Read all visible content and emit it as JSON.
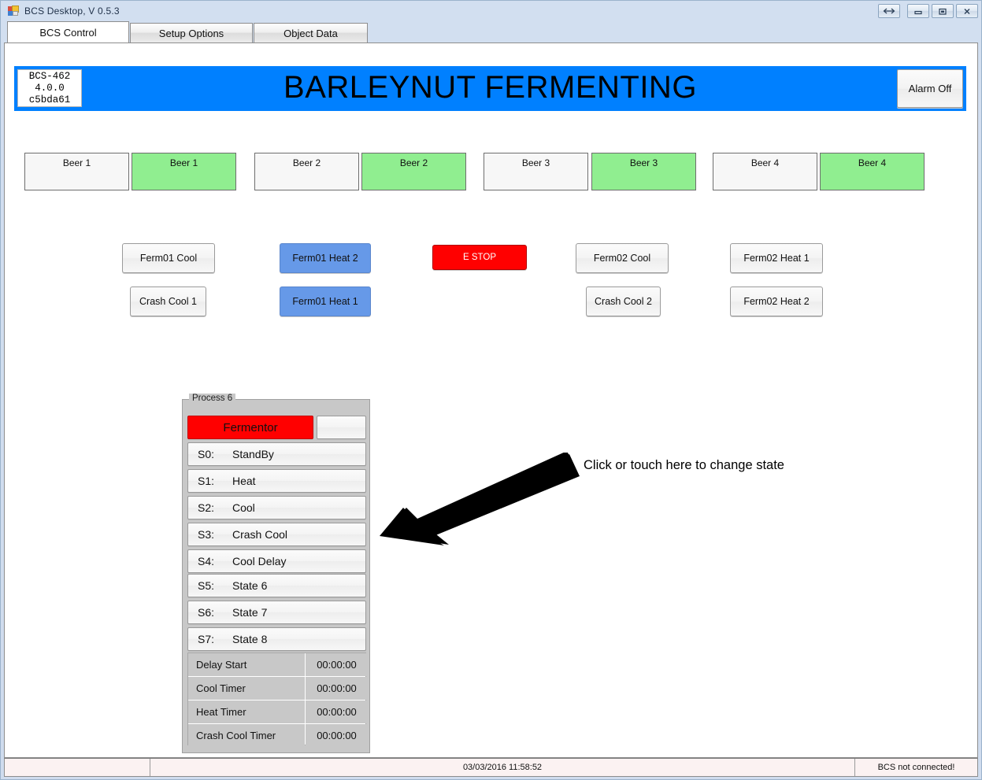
{
  "window": {
    "title": "BCS Desktop, V 0.5.3",
    "icon": "app-icon",
    "controls": [
      {
        "name": "restore-size-button",
        "icon": "double-arrow-icon"
      },
      {
        "name": "minimize-button",
        "icon": "minimize-icon"
      },
      {
        "name": "maximize-button",
        "icon": "maximize-icon"
      },
      {
        "name": "close-button",
        "icon": "close-icon"
      }
    ]
  },
  "tabs": [
    {
      "label": "BCS Control",
      "active": true
    },
    {
      "label": "Setup Options",
      "active": false
    },
    {
      "label": "Object Data",
      "active": false
    }
  ],
  "banner": {
    "title": "BARLEYNUT FERMENTING",
    "background_color": "#0080ff",
    "version": {
      "model": "BCS-462",
      "version": "4.0.0",
      "build": "c5bda61"
    },
    "alarm_button": "Alarm Off"
  },
  "beer_buttons": [
    {
      "label": "Beer 1",
      "state": "off"
    },
    {
      "label": "Beer 1",
      "state": "on"
    },
    {
      "label": "Beer 2",
      "state": "off"
    },
    {
      "label": "Beer 2",
      "state": "on"
    },
    {
      "label": "Beer 3",
      "state": "off"
    },
    {
      "label": "Beer 3",
      "state": "on"
    },
    {
      "label": "Beer 4",
      "state": "off"
    },
    {
      "label": "Beer 4",
      "state": "on"
    }
  ],
  "control_buttons": [
    {
      "label": "Ferm01 Cool",
      "state": "normal"
    },
    {
      "label": "Crash Cool 1",
      "state": "normal"
    },
    {
      "label": "Ferm01 Heat 2",
      "state": "active-blue"
    },
    {
      "label": "Ferm01 Heat 1",
      "state": "active-blue"
    },
    {
      "label": "E STOP",
      "state": "emergency-red"
    },
    {
      "label": "Ferm02 Cool",
      "state": "normal"
    },
    {
      "label": "Crash Cool 2",
      "state": "normal"
    },
    {
      "label": "Ferm02 Heat 1",
      "state": "normal"
    },
    {
      "label": "Ferm02 Heat 2",
      "state": "normal"
    }
  ],
  "colors": {
    "beer_on": "#90ee90",
    "beer_off": "#f7f7f7",
    "heat_active": "#6699e8",
    "estop": "#ff0000",
    "banner": "#0080ff",
    "fermentor_active": "#ff0000"
  },
  "process": {
    "legend": "Process 6",
    "fermentor_button": "Fermentor",
    "fermentor_aux": "",
    "states": [
      {
        "id": "S0:",
        "name": "StandBy"
      },
      {
        "id": "S1:",
        "name": "Heat"
      },
      {
        "id": "S2:",
        "name": "Cool"
      },
      {
        "id": "S3:",
        "name": "Crash Cool"
      },
      {
        "id": "S4:",
        "name": "Cool Delay"
      },
      {
        "id": "S5:",
        "name": "State 6"
      },
      {
        "id": "S6:",
        "name": "State 7"
      },
      {
        "id": "S7:",
        "name": "State 8"
      }
    ],
    "timers": [
      {
        "label": "Delay Start",
        "value": "00:00:00"
      },
      {
        "label": "Cool Timer",
        "value": "00:00:00"
      },
      {
        "label": "Heat Timer",
        "value": "00:00:00"
      },
      {
        "label": "Crash Cool Timer",
        "value": "00:00:00"
      }
    ]
  },
  "annotation": {
    "hint": "Click or touch here to change state",
    "arrow": "arrow-pointing-down-left-icon"
  },
  "statusbar": {
    "left": "",
    "datetime": "03/03/2016   11:58:52",
    "connection": "BCS not connected!"
  }
}
